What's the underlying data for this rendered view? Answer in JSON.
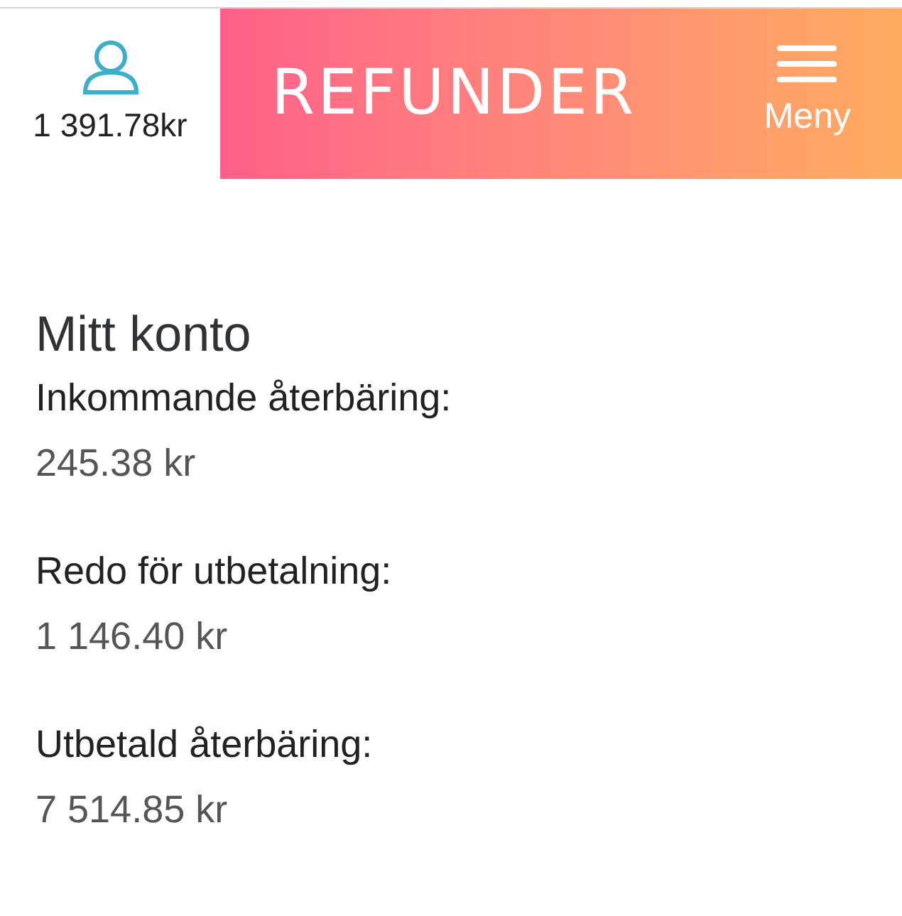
{
  "header": {
    "balance": "1 391.78kr",
    "logo": "REFUNDER",
    "menu_label": "Meny"
  },
  "account": {
    "title": "Mitt konto",
    "items": [
      {
        "label": "Inkommande återbäring:",
        "value": "245.38 kr"
      },
      {
        "label": "Redo för utbetalning:",
        "value": "1 146.40 kr"
      },
      {
        "label": "Utbetald återbäring:",
        "value": "7 514.85 kr"
      }
    ]
  }
}
